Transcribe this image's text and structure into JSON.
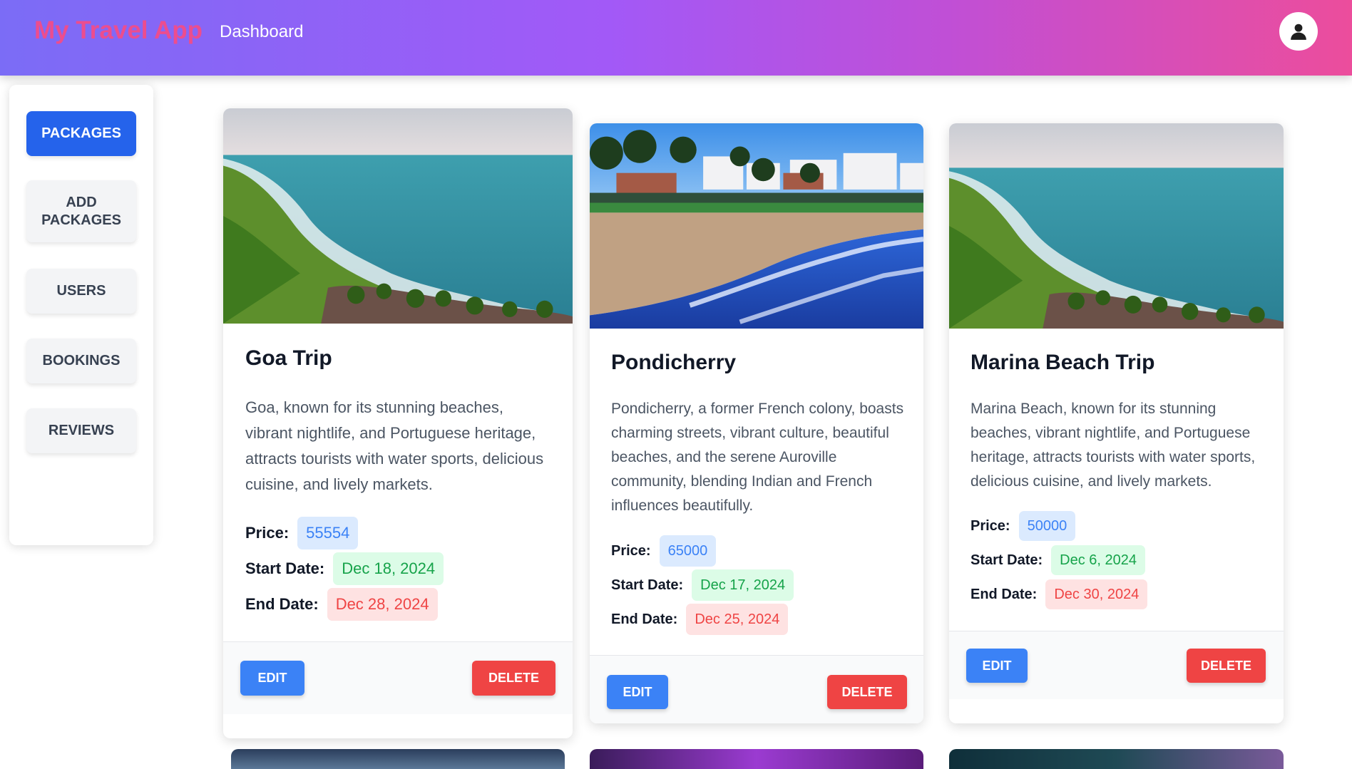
{
  "header": {
    "brand": "My Travel App",
    "nav_dashboard": "Dashboard",
    "avatar_icon": "user-icon"
  },
  "sidebar": {
    "items": [
      {
        "label": "PACKAGES",
        "active": true
      },
      {
        "label": "ADD PACKAGES",
        "active": false
      },
      {
        "label": "USERS",
        "active": false
      },
      {
        "label": "BOOKINGS",
        "active": false
      },
      {
        "label": "REVIEWS",
        "active": false
      }
    ]
  },
  "labels": {
    "price": "Price:",
    "start_date": "Start Date:",
    "end_date": "End Date:",
    "edit": "EDIT",
    "delete": "DELETE"
  },
  "packages": [
    {
      "title": "Goa Trip",
      "description": "Goa, known for its stunning beaches, vibrant nightlife, and Portuguese heritage, attracts tourists with water sports, delicious cuisine, and lively markets.",
      "price": "55554",
      "start_date": "Dec 18, 2024",
      "end_date": "Dec 28, 2024",
      "image": "coastal-cliff-beach-photo"
    },
    {
      "title": "Pondicherry",
      "description": "Pondicherry, a former French colony, boasts charming streets, vibrant culture, beautiful beaches, and the serene Auroville community, blending Indian and French influences beautifully.",
      "price": "65000",
      "start_date": "Dec 17, 2024",
      "end_date": "Dec 25, 2024",
      "image": "town-beach-photo"
    },
    {
      "title": "Marina Beach Trip",
      "description": "Marina Beach, known for its stunning beaches, vibrant nightlife, and Portuguese heritage, attracts tourists with water sports, delicious cuisine, and lively markets.",
      "price": "50000",
      "start_date": "Dec 6, 2024",
      "end_date": "Dec 30, 2024",
      "image": "coastal-cliff-beach-photo"
    }
  ],
  "colors": {
    "primary": "#2563eb",
    "edit": "#3b82f6",
    "delete": "#ef4444",
    "price_bg": "#dbeafe",
    "start_bg": "#dcfce7",
    "end_bg": "#fee2e2"
  }
}
